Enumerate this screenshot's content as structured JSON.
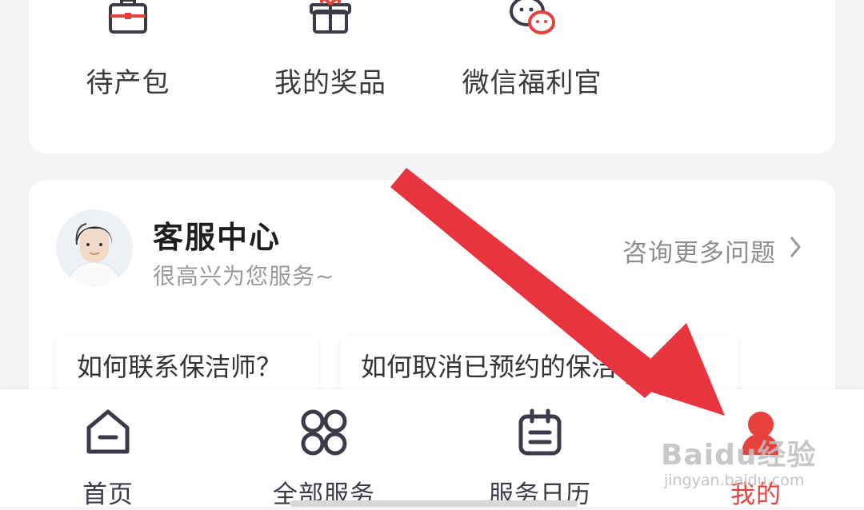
{
  "shortcuts": [
    {
      "label": "待产包",
      "icon": "bag-icon"
    },
    {
      "label": "我的奖品",
      "icon": "gift-icon"
    },
    {
      "label": "微信福利官",
      "icon": "wechat-chat-icon"
    }
  ],
  "service_center": {
    "title": "客服中心",
    "subtitle": "很高兴为您服务~",
    "more_link": "咨询更多问题",
    "faq": [
      "如何联系保洁师？",
      "如何取消已预约的保洁    ？"
    ]
  },
  "tabbar": {
    "tabs": [
      {
        "label": "首页",
        "icon": "home-icon",
        "active": false
      },
      {
        "label": "全部服务",
        "icon": "grid-icon",
        "active": false
      },
      {
        "label": "服务日历",
        "icon": "calendar-icon",
        "active": false
      },
      {
        "label": "我的",
        "icon": "profile-icon",
        "active": true
      }
    ]
  },
  "watermark": {
    "logo_text": "Baidu经验",
    "sub_text": "jingyan.baidu.com"
  },
  "colors": {
    "accent": "#e8403a",
    "icon_dark": "#3a3a48",
    "arrow": "#e8343e"
  }
}
